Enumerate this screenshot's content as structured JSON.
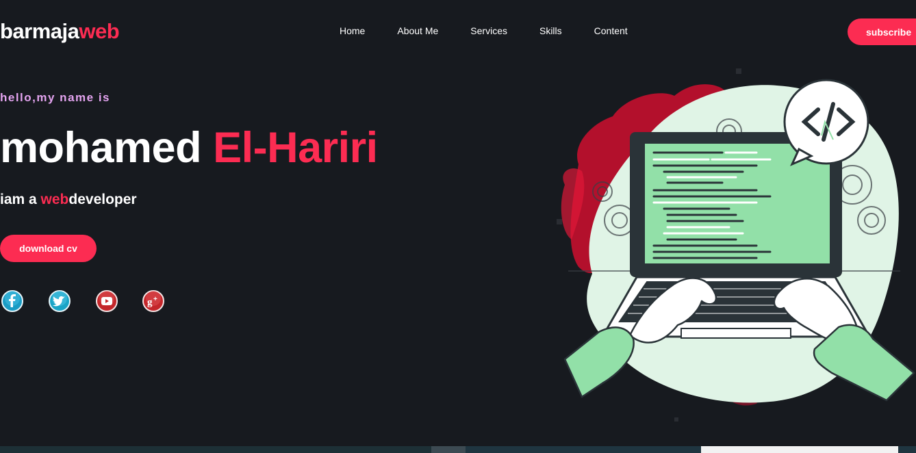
{
  "brand": {
    "name_main": "barmaja",
    "name_accent": "web"
  },
  "nav": {
    "items": [
      {
        "label": "Home"
      },
      {
        "label": "About Me"
      },
      {
        "label": "Services"
      },
      {
        "label": "Skills"
      },
      {
        "label": "Content"
      }
    ],
    "subscribe_label": "subscribe"
  },
  "hero": {
    "greeting": "hello,my name is",
    "first_name": "mohamed",
    "last_name": "El-Hariri",
    "role_prefix": "iam a ",
    "role_highlight": "web",
    "role_suffix": "developer",
    "download_label": "download cv"
  },
  "social": [
    {
      "icon": "facebook-icon",
      "glyph": "f",
      "color": "#1a9cc4"
    },
    {
      "icon": "twitter-icon",
      "glyph": "t",
      "color": "#1aa4c6"
    },
    {
      "icon": "youtube-icon",
      "glyph": "▶",
      "color": "#c4262a"
    },
    {
      "icon": "google-plus-icon",
      "glyph": "g+",
      "color": "#c4262a"
    }
  ],
  "colors": {
    "background": "#171a1f",
    "accent": "#fc2c52",
    "greeting": "#e4a4f0",
    "illustration_green": "#92e0a8",
    "illustration_pale": "#e0f4e6"
  }
}
